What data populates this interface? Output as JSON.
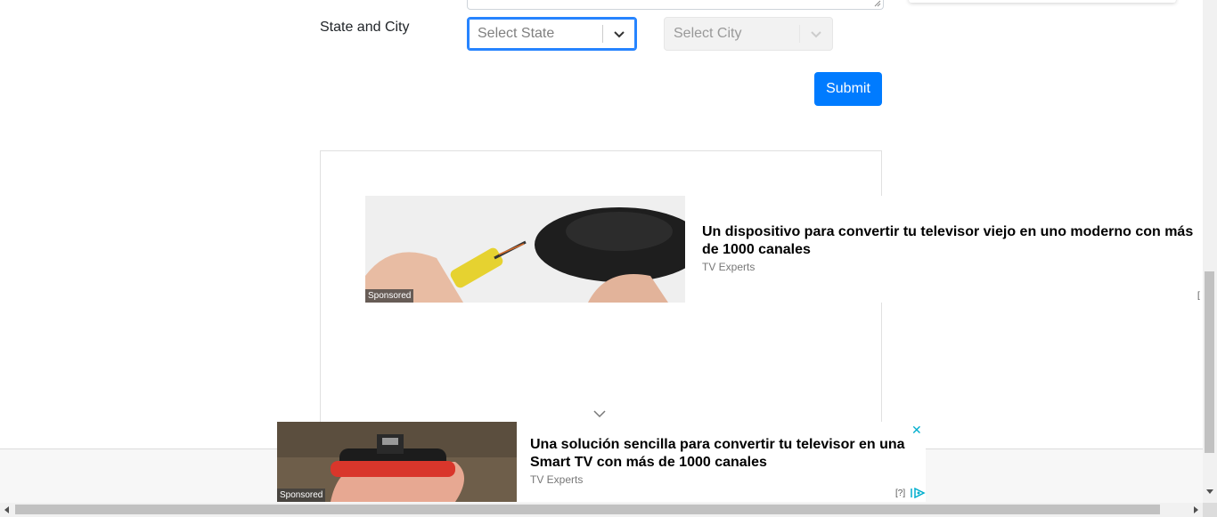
{
  "form": {
    "state_city_label": "State and City",
    "state_select": {
      "placeholder": "Select State"
    },
    "city_select": {
      "placeholder": "Select City"
    },
    "submit_label": "Submit"
  },
  "ad_inline": {
    "sponsored": "Sponsored",
    "headline": "Un dispositivo para convertir tu televisor viejo en uno moderno con más de 1000 canales",
    "source": "TV Experts",
    "info": "["
  },
  "ad_bottom": {
    "sponsored": "Sponsored",
    "headline": "Una solución sencilla para convertir tu televisor en una Smart TV con más de 1000 canales",
    "source": "TV Experts",
    "close": "✕",
    "info": "[?]"
  },
  "colors": {
    "primary": "#007bff",
    "focus_border": "#2684ff",
    "ad_close": "#00aecd"
  }
}
